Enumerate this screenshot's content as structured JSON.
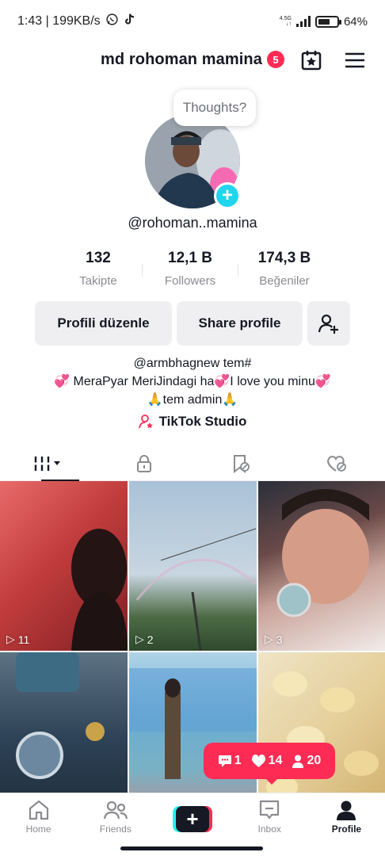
{
  "status_bar": {
    "time_and_speed": "1:43 | 199KB/s",
    "net_type_top": "4.5G",
    "net_type_bottom": "↓↑",
    "battery": "64%",
    "battery_level": 0.64
  },
  "header": {
    "title": "md rohoman mamina",
    "badge_count": "5"
  },
  "profile": {
    "thought_bubble": "Thoughts?",
    "handle": "@rohoman..mamina",
    "stats": [
      {
        "value": "132",
        "label": "Takipte"
      },
      {
        "value": "12,1 B",
        "label": "Followers"
      },
      {
        "value": "174,3 B",
        "label": "Beğeniler"
      }
    ],
    "edit_button": "Profili düzenle",
    "share_button": "Share profile",
    "bio_line1": "@armbhagnew tem#",
    "bio_line2": "💞 MeraPyar MeriJindagi ha💞I love you minu💞",
    "bio_line3": "🙏tem admin🙏",
    "studio_link": "TikTok Studio"
  },
  "tabs": [
    {
      "icon": "grid-icon",
      "active": true
    },
    {
      "icon": "lock-icon",
      "active": false
    },
    {
      "icon": "bookmark-icon",
      "active": false
    },
    {
      "icon": "liked-heart-icon",
      "active": false
    }
  ],
  "videos": [
    {
      "views": "11"
    },
    {
      "views": "2"
    },
    {
      "views": "3"
    },
    {
      "views": ""
    },
    {
      "views": ""
    },
    {
      "views": ""
    }
  ],
  "notification_pill": {
    "comments": "1",
    "likes": "14",
    "followers": "20"
  },
  "bottom_nav": {
    "home": "Home",
    "friends": "Friends",
    "inbox": "Inbox",
    "profile": "Profile"
  },
  "colors": {
    "accent": "#fe2c55",
    "cyan": "#25f4ee",
    "dark": "#161823",
    "muted": "#8a8b91"
  }
}
